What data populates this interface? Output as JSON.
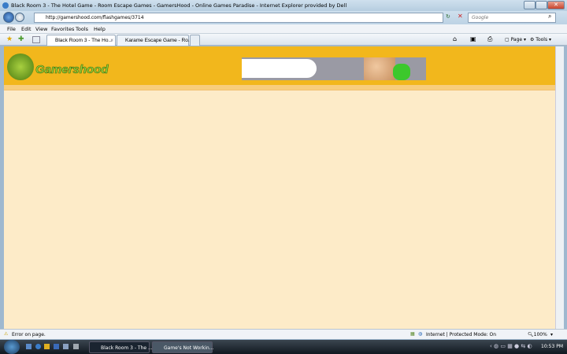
{
  "window": {
    "title": "Black Room 3 - The Hotel Game - Room Escape Games - GamersHood - Online Games Paradise - Internet Explorer provided by Dell"
  },
  "address": {
    "url": "http://gamershood.com/flashgames/3714"
  },
  "search": {
    "placeholder": "Google"
  },
  "menu": [
    "File",
    "Edit",
    "View",
    "Favorites",
    "Tools",
    "Help"
  ],
  "tabs": [
    {
      "label": "Black Room 3 - The Ho..."
    },
    {
      "label": "Karame Escape Game - Ro..."
    }
  ],
  "toolbar": {
    "page": "Page",
    "tools": "Tools"
  },
  "site": {
    "logo": "Gamershood"
  },
  "status": {
    "left": "Error on page.",
    "zone": "Internet | Protected Mode: On",
    "zoom": "100%"
  },
  "taskbar": {
    "items": [
      {
        "label": "Black Room 3 - The ..."
      },
      {
        "label": "Game's Not Workin..."
      }
    ],
    "clock": "10:53 PM"
  }
}
